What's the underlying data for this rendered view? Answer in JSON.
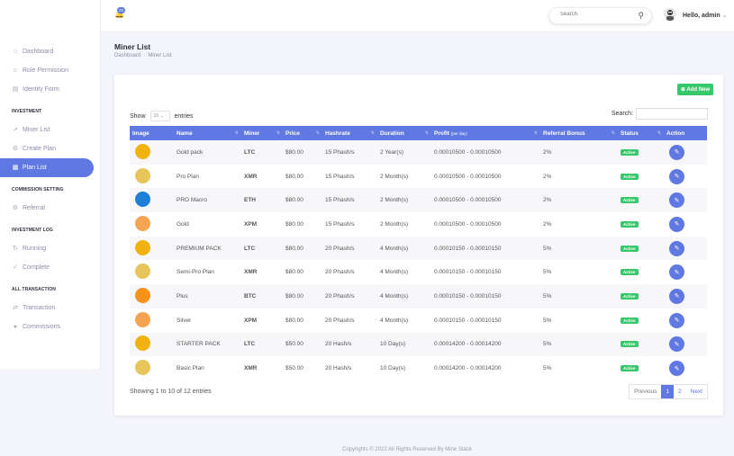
{
  "topbar": {
    "notification_count": "20",
    "search_placeholder": "Search",
    "greeting": "Hello, admin"
  },
  "sidebar": {
    "items": [
      {
        "label": "Dashboard"
      },
      {
        "label": "Role Permission"
      },
      {
        "label": "Identity Form"
      }
    ],
    "section_investment": "INVESTMENT",
    "investment_items": [
      {
        "label": "Miner List"
      },
      {
        "label": "Create Plan"
      },
      {
        "label": "Plan List"
      }
    ],
    "section_commission": "COMMISSION SETTING",
    "commission_items": [
      {
        "label": "Referral"
      }
    ],
    "section_log": "INVESTMENT LOG",
    "log_items": [
      {
        "label": "Running"
      },
      {
        "label": "Complete"
      }
    ],
    "section_transaction": "ALL TRANSACTION",
    "transaction_items": [
      {
        "label": "Transaction"
      },
      {
        "label": "Commissions"
      }
    ]
  },
  "page": {
    "title": "Miner List",
    "breadcrumb_home": "Dashboard",
    "breadcrumb_current": "Miner List"
  },
  "card": {
    "add_new": "Add New",
    "show_label": "Show",
    "show_value": "10",
    "entries_label": "entries",
    "search_label": "Search:",
    "columns": [
      "Image",
      "Name",
      "Miner",
      "Price",
      "Hashrate",
      "Duration",
      "Profit",
      "Referral Bonus",
      "Status",
      "Action"
    ],
    "profit_sub": "(per day)",
    "rows": [
      {
        "name": "Gold pack",
        "miner": "LTC",
        "price": "$80.00",
        "hashrate": "15 Phash/s",
        "duration": "2 Year(s)",
        "profit": "0.00010500 - 0.00010500",
        "bonus": "2%",
        "status": "Active",
        "color": "#f2b311"
      },
      {
        "name": "Pro Plan",
        "miner": "XMR",
        "price": "$80.00",
        "hashrate": "15 Phash/s",
        "duration": "2 Month(s)",
        "profit": "0.00010500 - 0.00010500",
        "bonus": "2%",
        "status": "Active",
        "color": "#e8c55a"
      },
      {
        "name": "PRO Macro",
        "miner": "ETH",
        "price": "$80.00",
        "hashrate": "15 Phash/s",
        "duration": "2 Month(s)",
        "profit": "0.00010500 - 0.00010500",
        "bonus": "2%",
        "status": "Active",
        "color": "#1e7fd6"
      },
      {
        "name": "Gold",
        "miner": "XPM",
        "price": "$80.00",
        "hashrate": "15 Phash/s",
        "duration": "2 Month(s)",
        "profit": "0.00010500 - 0.00010500",
        "bonus": "2%",
        "status": "Active",
        "color": "#f5a552"
      },
      {
        "name": "PREMIUM PACK",
        "miner": "LTC",
        "price": "$80.00",
        "hashrate": "20 Phash/s",
        "duration": "4 Month(s)",
        "profit": "0.00010150 - 0.00010150",
        "bonus": "5%",
        "status": "Active",
        "color": "#f2b311"
      },
      {
        "name": "Semi-Pro Plan",
        "miner": "XMR",
        "price": "$80.00",
        "hashrate": "20 Phash/s",
        "duration": "4 Month(s)",
        "profit": "0.00010150 - 0.00010150",
        "bonus": "5%",
        "status": "Active",
        "color": "#e8c55a"
      },
      {
        "name": "Plus",
        "miner": "BTC",
        "price": "$80.00",
        "hashrate": "20 Phash/s",
        "duration": "4 Month(s)",
        "profit": "0.00010150 - 0.00010150",
        "bonus": "5%",
        "status": "Active",
        "color": "#f7931a"
      },
      {
        "name": "Silver",
        "miner": "XPM",
        "price": "$80.00",
        "hashrate": "20 Phash/s",
        "duration": "4 Month(s)",
        "profit": "0.00010150 - 0.00010150",
        "bonus": "5%",
        "status": "Active",
        "color": "#f5a552"
      },
      {
        "name": "STARTER PACK",
        "miner": "LTC",
        "price": "$50.00",
        "hashrate": "20 Hash/s",
        "duration": "10 Day(s)",
        "profit": "0.00014200 - 0.00014200",
        "bonus": "5%",
        "status": "Active",
        "color": "#f2b311"
      },
      {
        "name": "Basic Plan",
        "miner": "XMR",
        "price": "$50.00",
        "hashrate": "20 Hash/s",
        "duration": "10 Day(s)",
        "profit": "0.00014200 - 0.00014200",
        "bonus": "5%",
        "status": "Active",
        "color": "#e8c55a"
      }
    ],
    "info": "Showing 1 to 10 of 12 entries",
    "pager": {
      "prev": "Previous",
      "p1": "1",
      "p2": "2",
      "next": "Next"
    }
  },
  "footer": "Copyrights © 2022 All Rights Reserved By Mine Stack"
}
